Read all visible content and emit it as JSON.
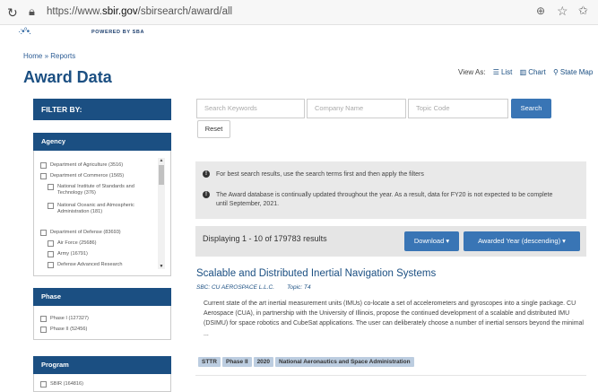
{
  "browser": {
    "url_prefix": "https://www.",
    "url_domain": "sbir.gov",
    "url_path": "/sbirsearch/award/all"
  },
  "brand": {
    "powered": "POWERED BY SBA"
  },
  "breadcrumb": {
    "home": "Home",
    "sep": " » ",
    "reports": "Reports"
  },
  "page_title": "Award Data",
  "view_as": {
    "label": "View As:",
    "list": "List",
    "chart": "Chart",
    "state_map": "State Map"
  },
  "sidebar": {
    "filter_by": "FILTER BY:",
    "agency": {
      "title": "Agency",
      "items": [
        "Department of Agriculture (3516)",
        "Department of Commerce (1565)",
        "National Institute of Standards and Technology (376)",
        "National Oceanic and Atmospheric Administration (181)",
        "Department of Defense (83693)",
        "Air Force (25686)",
        "Army (16791)",
        "Defense Advanced Research"
      ]
    },
    "phase": {
      "title": "Phase",
      "items": [
        "Phase I (127327)",
        "Phase II (52456)"
      ]
    },
    "program": {
      "title": "Program",
      "items": [
        "SBIR (164816)"
      ]
    }
  },
  "search": {
    "keywords_placeholder": "Search Keywords",
    "company_placeholder": "Company Name",
    "topic_placeholder": "Topic Code",
    "search_label": "Search",
    "reset_label": "Reset"
  },
  "notices": [
    "For best search results, use the search terms first and then apply the filters",
    "The Award database is continually updated throughout the year. As a result, data for FY20 is not expected to be complete until September, 2021."
  ],
  "results": {
    "count_text": "Displaying 1 - 10 of 179783 results",
    "download_label": "Download",
    "sort_label": "Awarded Year (descending)"
  },
  "award": {
    "title": "Scalable and Distributed Inertial Navigation Systems",
    "company": "SBC: CU AEROSPACE L.L.C.",
    "topic": "Topic: T4",
    "description": "Current state of the art inertial measurement units (IMUs) co-locate a set of accelerometers and gyroscopes into a single package. CU Aerospace (CUA), in partnership with the University of Illinois, propose the continued development of a scalable and distributed IMU (DSIMU) for space robotics and CubeSat applications. The user can deliberately choose a number of inertial sensors beyond the minimal ...",
    "tags": [
      "STTR",
      "Phase II",
      "2020",
      "National Aeronautics and Space Administration"
    ]
  },
  "icons": {
    "reload": "reload-icon",
    "lock": "lock-icon",
    "zoom": "zoom-icon",
    "star": "star-icon",
    "list": "list-icon",
    "chart": "bar-chart-icon",
    "map": "map-pin-icon",
    "info": "info-icon"
  }
}
